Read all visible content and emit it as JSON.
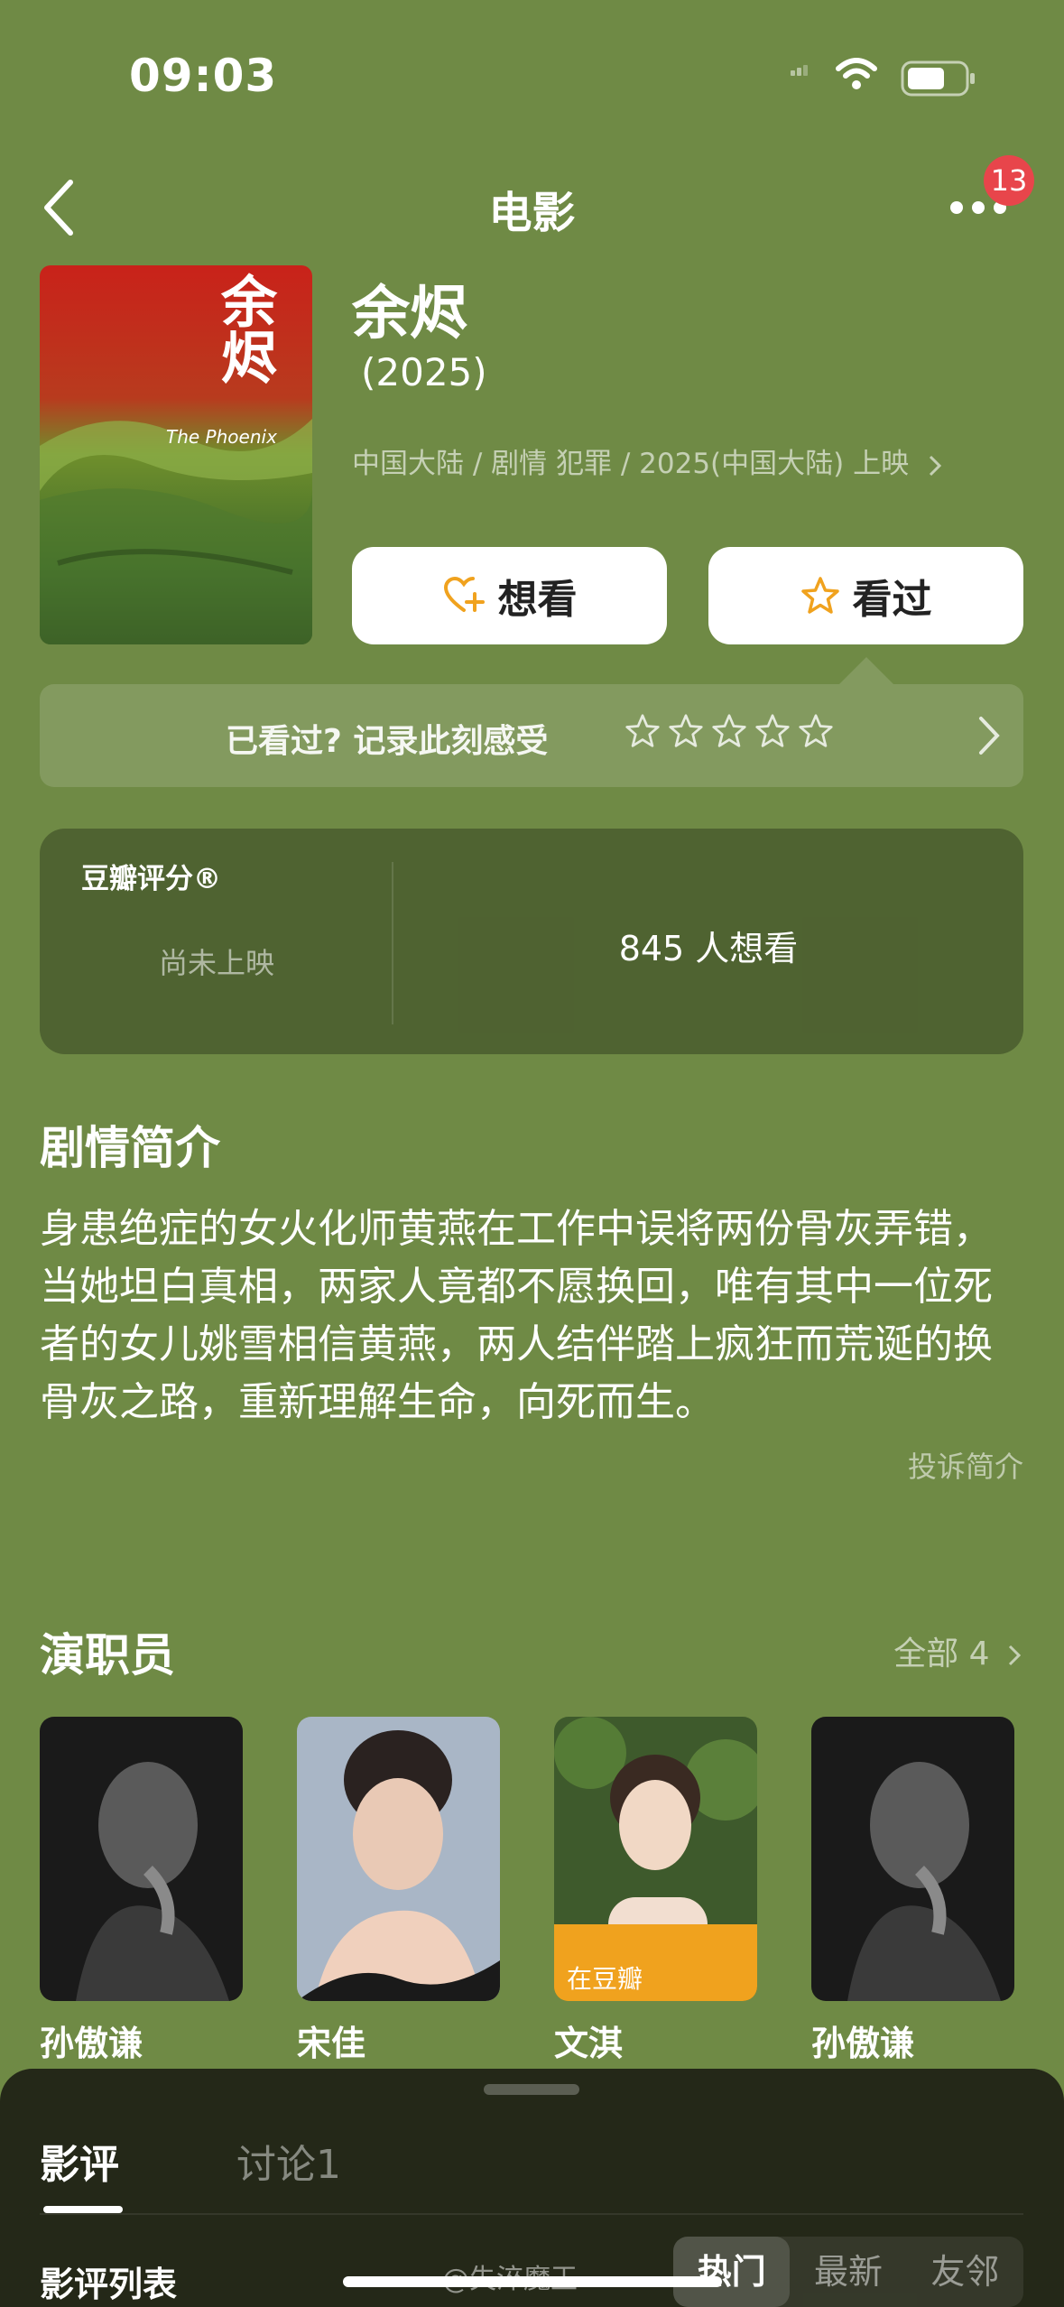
{
  "status_bar": {
    "time": "09:03"
  },
  "nav": {
    "title": "电影",
    "badge_count": "13"
  },
  "movie": {
    "title": "余烬",
    "year": "(2025)",
    "meta": "中国大陆 / 剧情 犯罪 / 2025(中国大陆) 上映",
    "poster_title": "余烬",
    "poster_subtitle": "The Phoenix"
  },
  "actions": {
    "want_label": "想看",
    "seen_label": "看过"
  },
  "rate_prompt": {
    "text": "已看过? 记录此刻感受",
    "stars": 5
  },
  "rating": {
    "label": "豆瓣评分®",
    "status": "尚未上映",
    "want_count": "845 人想看"
  },
  "synopsis": {
    "heading": "剧情简介",
    "text": "身患绝症的女火化师黄燕在工作中误将两份骨灰弄错，当她坦白真相，两家人竟都不愿换回，唯有其中一位死者的女儿姚雪相信黄燕，两人结伴踏上疯狂而荒诞的换骨灰之路，重新理解生命，向死而生。",
    "report_label": "投诉简介"
  },
  "cast": {
    "heading": "演职员",
    "all_label": "全部 4",
    "members": [
      {
        "name": "孙傲谦",
        "tag": ""
      },
      {
        "name": "宋佳",
        "tag": ""
      },
      {
        "name": "文淇",
        "tag": "在豆瓣"
      },
      {
        "name": "孙傲谦",
        "tag": ""
      }
    ]
  },
  "sheet": {
    "tabs": [
      "影评",
      "讨论1"
    ],
    "list_label": "影评列表",
    "segments": [
      "热门",
      "最新",
      "友邻"
    ],
    "watermark": "@失淬魔王"
  },
  "colors": {
    "background": "#6f8a45",
    "accent": "#f0a21e",
    "badge": "#e8454b"
  }
}
